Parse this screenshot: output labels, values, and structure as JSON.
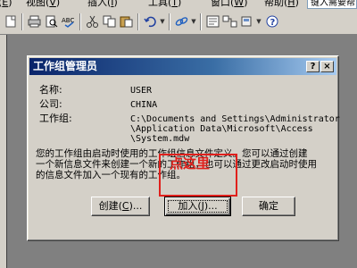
{
  "menubar": {
    "items": [
      {
        "pre": "(",
        "acc": "E",
        "post": ")"
      },
      {
        "pre": "视图(",
        "acc": "V",
        "post": ")"
      },
      {
        "pre": "插入(",
        "acc": "I",
        "post": ")"
      },
      {
        "pre": "工具(",
        "acc": "T",
        "post": ")"
      },
      {
        "pre": "窗口(",
        "acc": "W",
        "post": ")"
      },
      {
        "pre": "帮助(",
        "acc": "H",
        "post": ")"
      }
    ],
    "help_search": "键入需要帮"
  },
  "toolbar": {
    "icons": [
      "new-icon",
      "print-icon",
      "print-preview-icon",
      "spell-check-icon",
      "cut-icon",
      "copy-icon",
      "paste-icon",
      "undo-icon",
      "link-icon",
      "properties-icon",
      "relationships-icon",
      "new-object-icon",
      "help-icon"
    ]
  },
  "dialog": {
    "title": "工作组管理员",
    "help_btn": "?",
    "close_btn": "×",
    "name_label": "名称:",
    "name_value": "USER",
    "company_label": "公司:",
    "company_value": "CHINA",
    "workgroup_label": "工作组:",
    "workgroup_path": [
      "C:\\Documents and Settings\\Administrator",
      "\\Application Data\\Microsoft\\Access",
      "\\System.mdw"
    ],
    "description": [
      "您的工作组由启动时使用的工作组信息文件定义。您可以通过创建",
      "一个新信息文件来创建一个新的工作组，也可以通过更改启动时使用",
      "的信息文件加入一个现有的工作组。"
    ],
    "create_button": {
      "pre": "创建(",
      "acc": "C",
      "post": ")..."
    },
    "join_button": {
      "pre": "加入(",
      "acc": "J",
      "post": ")..."
    },
    "ok_button": "确定"
  },
  "annotation": {
    "text": "点这里",
    "color": "#e0201c"
  }
}
